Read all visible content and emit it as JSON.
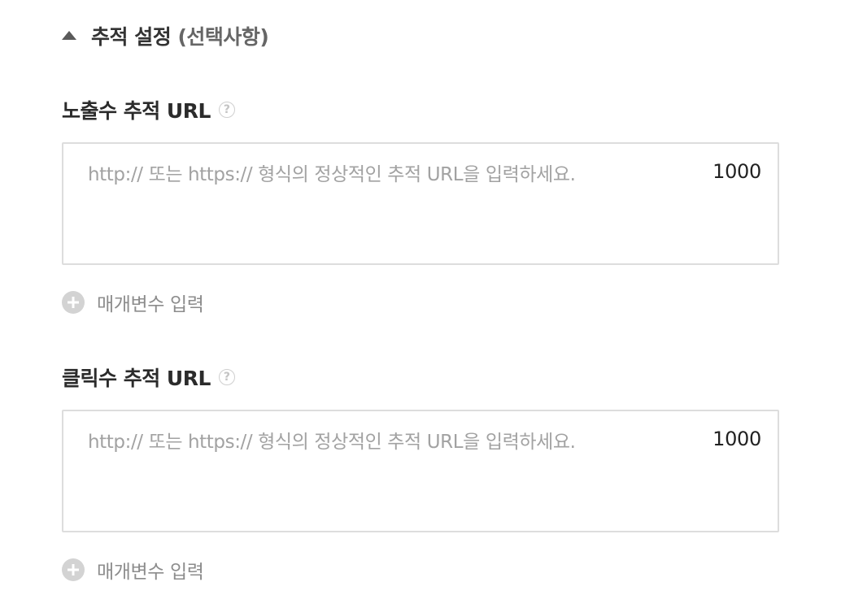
{
  "section": {
    "title": "추적 설정",
    "optional_note": "(선택사항)",
    "collapse_icon": "triangle-up-icon"
  },
  "impression": {
    "label": "노출수 추적 URL",
    "help_icon": "question-circle-icon",
    "help_glyph": "?",
    "placeholder": "http:// 또는 https:// 형식의 정상적인 추적 URL을 입력하세요.",
    "value": "",
    "counter": "1000",
    "param_button": "매개변수 입력",
    "param_icon": "plus-circle-icon"
  },
  "click": {
    "label": "클릭수 추적 URL",
    "help_icon": "question-circle-icon",
    "help_glyph": "?",
    "placeholder": "http:// 또는 https:// 형식의 정상적인 추적 URL을 입력하세요.",
    "value": "",
    "counter": "1000",
    "param_button": "매개변수 입력",
    "param_icon": "plus-circle-icon"
  },
  "colors": {
    "label": "#2b2b2b",
    "placeholder": "#a2a2a2",
    "border": "#dddddd",
    "muted": "#8c8c8c",
    "icon": "#d3d3d3"
  }
}
